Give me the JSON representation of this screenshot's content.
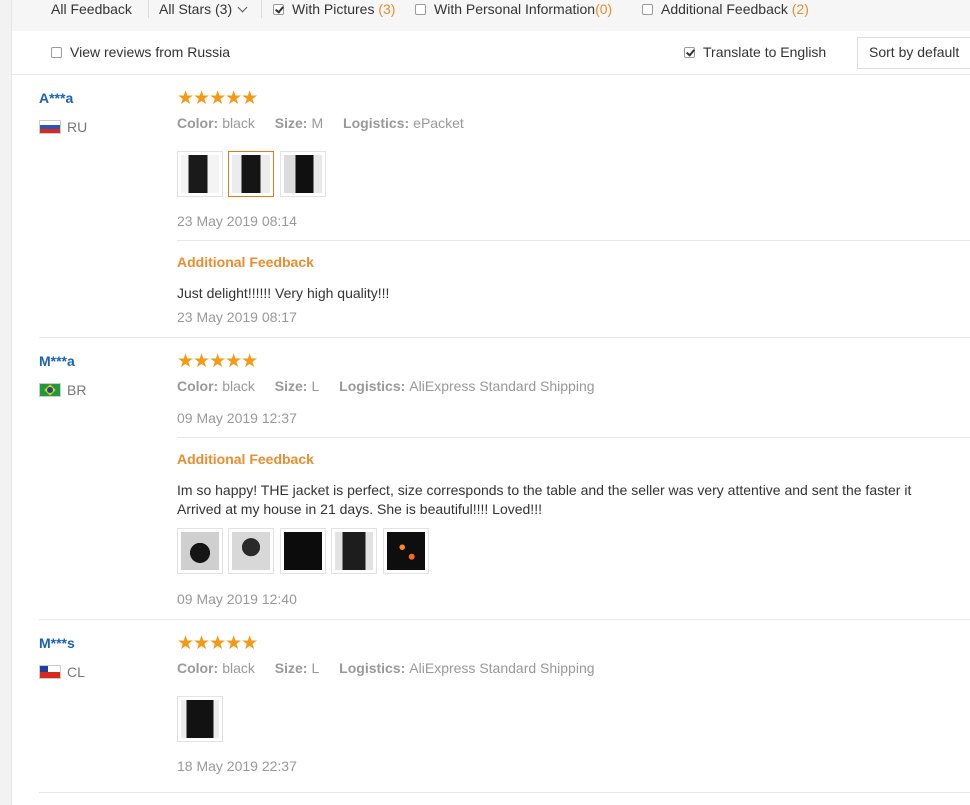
{
  "filters": {
    "all_feedback": "All Feedback",
    "all_stars": "All Stars (3)",
    "with_pictures": "With Pictures",
    "with_pictures_count": "(3)",
    "with_personal_info": "With Personal Information",
    "with_personal_info_count": "(0)",
    "additional_feedback": "Additional Feedback",
    "additional_feedback_count": "(2)"
  },
  "options": {
    "view_country": "View reviews from Russia",
    "translate": "Translate to English",
    "sort": "Sort by default"
  },
  "labels": {
    "color": "Color:",
    "size": "Size:",
    "logistics": "Logistics:",
    "additional_feedback_title": "Additional Feedback"
  },
  "reviews": [
    {
      "user": "A***a",
      "country": "RU",
      "stars": "★★★★★",
      "color": "black",
      "size": "M",
      "logistics": "ePacket",
      "date": "23 May 2019 08:14",
      "additional_text": "Just delight!!!!!! Very high quality!!!",
      "additional_date": "23 May 2019 08:17"
    },
    {
      "user": "M***a",
      "country": "BR",
      "stars": "★★★★★",
      "color": "black",
      "size": "L",
      "logistics": "AliExpress Standard Shipping",
      "date": "09 May 2019 12:37",
      "additional_text_1": "Im so happy! THE jacket is perfect, size corresponds to the table and the seller was very attentive and sent the faster it",
      "additional_text_2": "Arrived at my house in 21 days. She is beautiful!!!! Loved!!!",
      "additional_date": "09 May 2019 12:40"
    },
    {
      "user": "M***s",
      "country": "CL",
      "stars": "★★★★★",
      "color": "black",
      "size": "L",
      "logistics": "AliExpress Standard Shipping",
      "date": "18 May 2019 22:37"
    }
  ]
}
